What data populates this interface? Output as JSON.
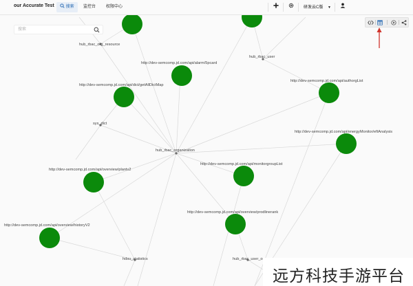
{
  "app": {
    "title": "our Accurate Test"
  },
  "nav": {
    "tabs": [
      {
        "label": "搜索",
        "active": true
      },
      {
        "label": "监控台",
        "active": false
      },
      {
        "label": "权限中心",
        "active": false
      }
    ]
  },
  "topbar": {
    "add_icon": "plus-icon",
    "settings_icon": "gear-icon",
    "tenant_label": "研发云C版",
    "tenant_icon": "caret-down-icon",
    "user_icon": "user-icon"
  },
  "search": {
    "placeholder": "搜索"
  },
  "graph_toolbar": {
    "tools": [
      "code-icon",
      "table-icon",
      "play-icon",
      "share-icon"
    ],
    "highlight_color": "#d0342c"
  },
  "colors": {
    "node_green": "#0b8a0b",
    "edge": "#d8d8d8",
    "dot": "#6b6b6b",
    "accent": "#2f6fb5"
  },
  "graph": {
    "hub_nodes": [
      {
        "id": "org",
        "label": "hub_rbac_organization"
      },
      {
        "id": "res",
        "label": "hub_rbac_org_resource"
      },
      {
        "id": "usr",
        "label": "hub_rbac_user"
      },
      {
        "id": "dict",
        "label": "sys_dict"
      },
      {
        "id": "stat",
        "label": "hdsu_statistics"
      },
      {
        "id": "uorg",
        "label": "hub_rbac_user_org"
      }
    ],
    "api_nodes": [
      {
        "id": "n1",
        "label": ""
      },
      {
        "id": "n2",
        "label": ""
      },
      {
        "id": "alarm",
        "label": "http://dev-semcomp.jd.com/api/alarm/5pcard"
      },
      {
        "id": "dict_api",
        "label": "http://dev-semcomp.jd.com/api/dict/getAllDictMap"
      },
      {
        "id": "auth",
        "label": "http://dev-semcomp.jd.com/api/authorgList"
      },
      {
        "id": "energy",
        "label": "http://dev-semcomp.jd.com/api/energyMonitor/eftAnalysis"
      },
      {
        "id": "plant",
        "label": "http://dev-semcomp.jd.com/api/overview/plantv2"
      },
      {
        "id": "monitor",
        "label": "http://dev-semcomp.jd.com/api/monitorgroupList"
      },
      {
        "id": "prod",
        "label": "http://dev-semcomp.jd.com/api/overview/prodlinerank"
      },
      {
        "id": "hist",
        "label": "http://dev-semcomp.jd.com/api/overview/historyV2"
      }
    ]
  },
  "watermark": {
    "text": "远方科技手游平台"
  }
}
